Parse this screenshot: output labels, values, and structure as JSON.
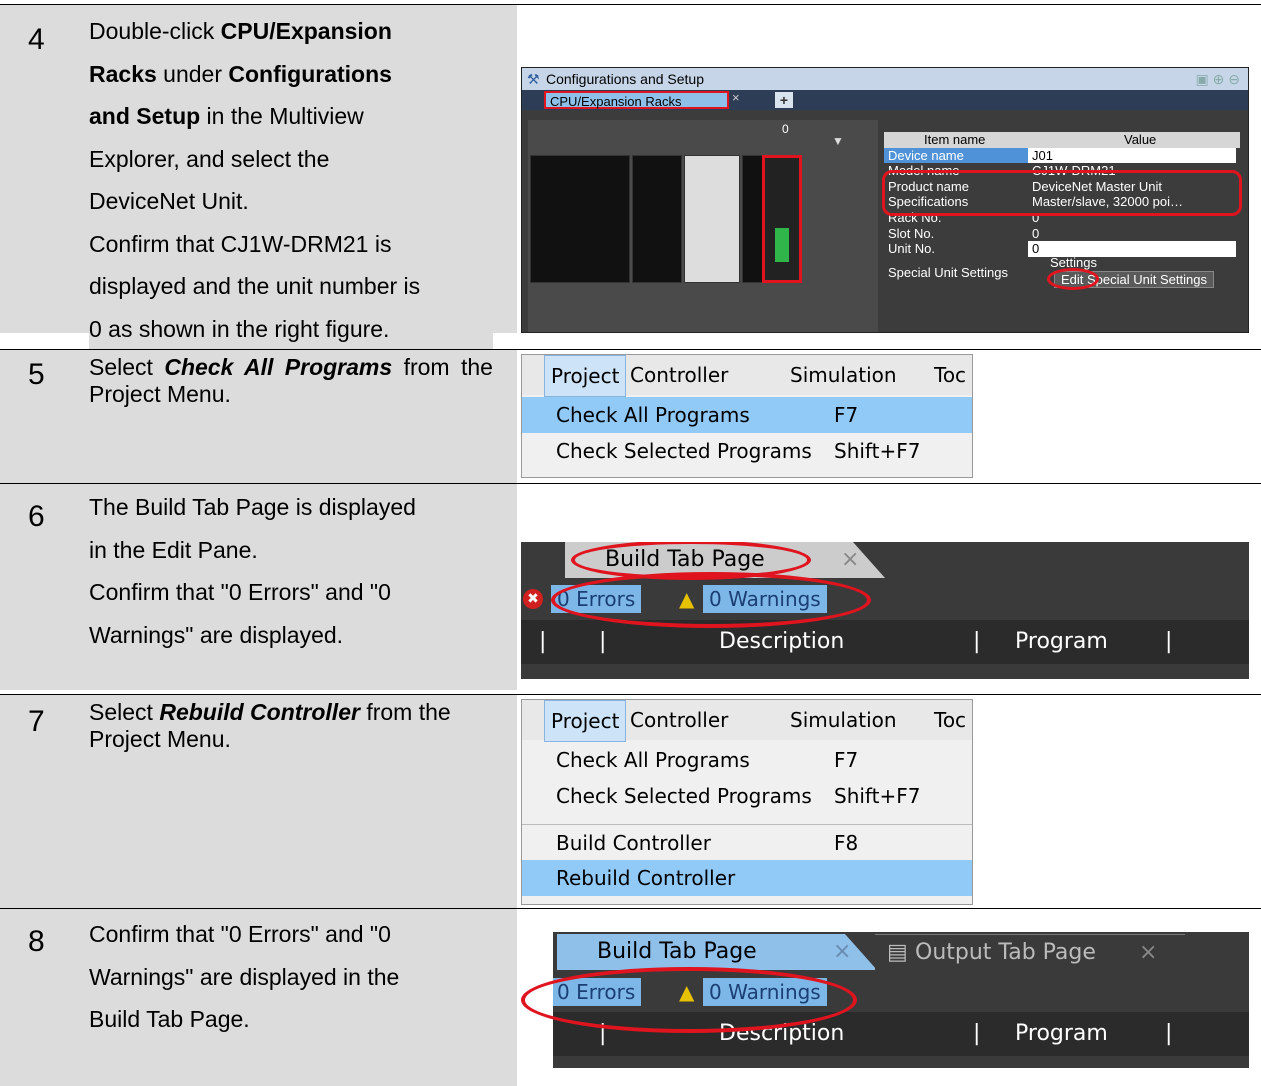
{
  "steps": [
    {
      "number": "4",
      "lines": [
        [
          "Double-click ",
          {
            "b": "CPU/Expansion"
          }
        ],
        [
          {
            "b": "Racks"
          },
          " under ",
          {
            "b": "Configurations"
          }
        ],
        [
          {
            "b": "and Setup"
          },
          " in the Multiview"
        ],
        [
          "Explorer, and select the"
        ],
        [
          "DeviceNet Unit."
        ],
        [
          "Confirm that CJ1W-DRM21 is"
        ],
        [
          "displayed and the unit number is"
        ],
        [
          "0 as shown in the right figure."
        ]
      ]
    },
    {
      "number": "5",
      "text_pre": "Select ",
      "text_em": "Check All Programs",
      "text_post": " from the Project Menu."
    },
    {
      "number": "6",
      "lines": [
        [
          "The Build Tab Page is displayed"
        ],
        [
          "in the Edit Pane."
        ],
        [
          "Confirm that \"0 Errors\" and \"0"
        ],
        [
          "Warnings\" are displayed."
        ]
      ]
    },
    {
      "number": "7",
      "text_pre": "Select ",
      "text_em": "Rebuild Controller",
      "text_post": " from the Project Menu."
    },
    {
      "number": "8",
      "lines": [
        [
          "Confirm that \"0 Errors\" and \"0"
        ],
        [
          "Warnings\" are displayed in the"
        ],
        [
          "Build Tab Page."
        ]
      ]
    }
  ],
  "config": {
    "title": "Configurations and Setup",
    "tab": "CPU/Expansion Racks",
    "tab_close": "×",
    "tab_add": "+",
    "slot_label": "0",
    "col_item": "Item name",
    "col_value": "Value",
    "rows": [
      {
        "k": "Device name",
        "v": "J01"
      },
      {
        "k": "Model name",
        "v": "CJ1W-DRM21"
      },
      {
        "k": "Product name",
        "v": "DeviceNet Master Unit"
      },
      {
        "k": "Specifications",
        "v": "Master/slave, 32000 poi…"
      },
      {
        "k": "Rack No.",
        "v": "0"
      },
      {
        "k": "Slot No.",
        "v": "0"
      },
      {
        "k": "Unit No.",
        "v": "0"
      }
    ],
    "special_label": "Special Unit Settings",
    "settings_label": "Settings",
    "edit_button": "Edit Special Unit Settings"
  },
  "menu1": {
    "bar": [
      "Project",
      "Controller",
      "Simulation",
      "Toc"
    ],
    "items": [
      {
        "label": "Check All Programs",
        "key": "F7"
      },
      {
        "label": "Check Selected Programs",
        "key": "Shift+F7"
      }
    ]
  },
  "menu2": {
    "bar": [
      "Project",
      "Controller",
      "Simulation",
      "Toc"
    ],
    "items": [
      {
        "label": "Check All Programs",
        "key": "F7"
      },
      {
        "label": "Check Selected Programs",
        "key": "Shift+F7"
      },
      {
        "label": "Build Controller",
        "key": "F8"
      },
      {
        "label": "Rebuild Controller",
        "key": ""
      }
    ]
  },
  "build1": {
    "tab": "Build Tab Page",
    "close": "×",
    "errors": "0 Errors",
    "warnings": "0 Warnings",
    "col_desc": "Description",
    "col_prog": "Program"
  },
  "build2": {
    "tab": "Build Tab Page",
    "close": "×",
    "tab2": "Output Tab Page",
    "close2": "×",
    "errors": "0 Errors",
    "warnings": "0 Warnings",
    "col_desc": "Description",
    "col_prog": "Program"
  }
}
